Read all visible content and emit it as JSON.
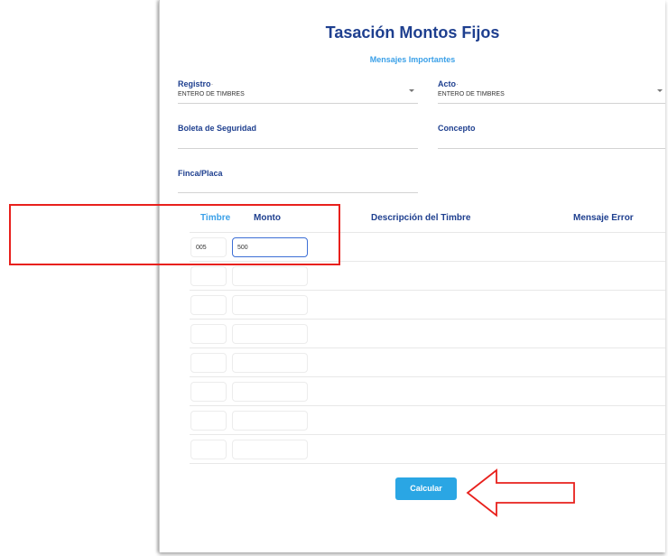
{
  "header": {
    "title": "Tasación Montos Fijos",
    "subtitle": "Mensajes Importantes"
  },
  "fields": {
    "registro": {
      "label": "Registro",
      "required_mark": "·",
      "value": "ENTERO DE TIMBRES"
    },
    "acto": {
      "label": "Acto",
      "required_mark": "·",
      "value": "ENTERO DE TIMBRES"
    },
    "boleta": {
      "label": "Boleta de Seguridad",
      "value": ""
    },
    "concepto": {
      "label": "Concepto",
      "value": ""
    },
    "finca": {
      "label": "Finca/Placa",
      "value": ""
    }
  },
  "table": {
    "columns": [
      "Timbre",
      "Monto",
      "Descripción del Timbre",
      "Mensaje Error"
    ],
    "rows": [
      {
        "timbre": "005",
        "monto": "500"
      },
      {
        "timbre": "",
        "monto": ""
      },
      {
        "timbre": "",
        "monto": ""
      },
      {
        "timbre": "",
        "monto": ""
      },
      {
        "timbre": "",
        "monto": ""
      },
      {
        "timbre": "",
        "monto": ""
      },
      {
        "timbre": "",
        "monto": ""
      },
      {
        "timbre": "",
        "monto": ""
      }
    ]
  },
  "actions": {
    "calcular_label": "Calcular"
  },
  "annotations": {
    "highlight_color": "#e8201c",
    "arrow_color": "#e8201c"
  }
}
